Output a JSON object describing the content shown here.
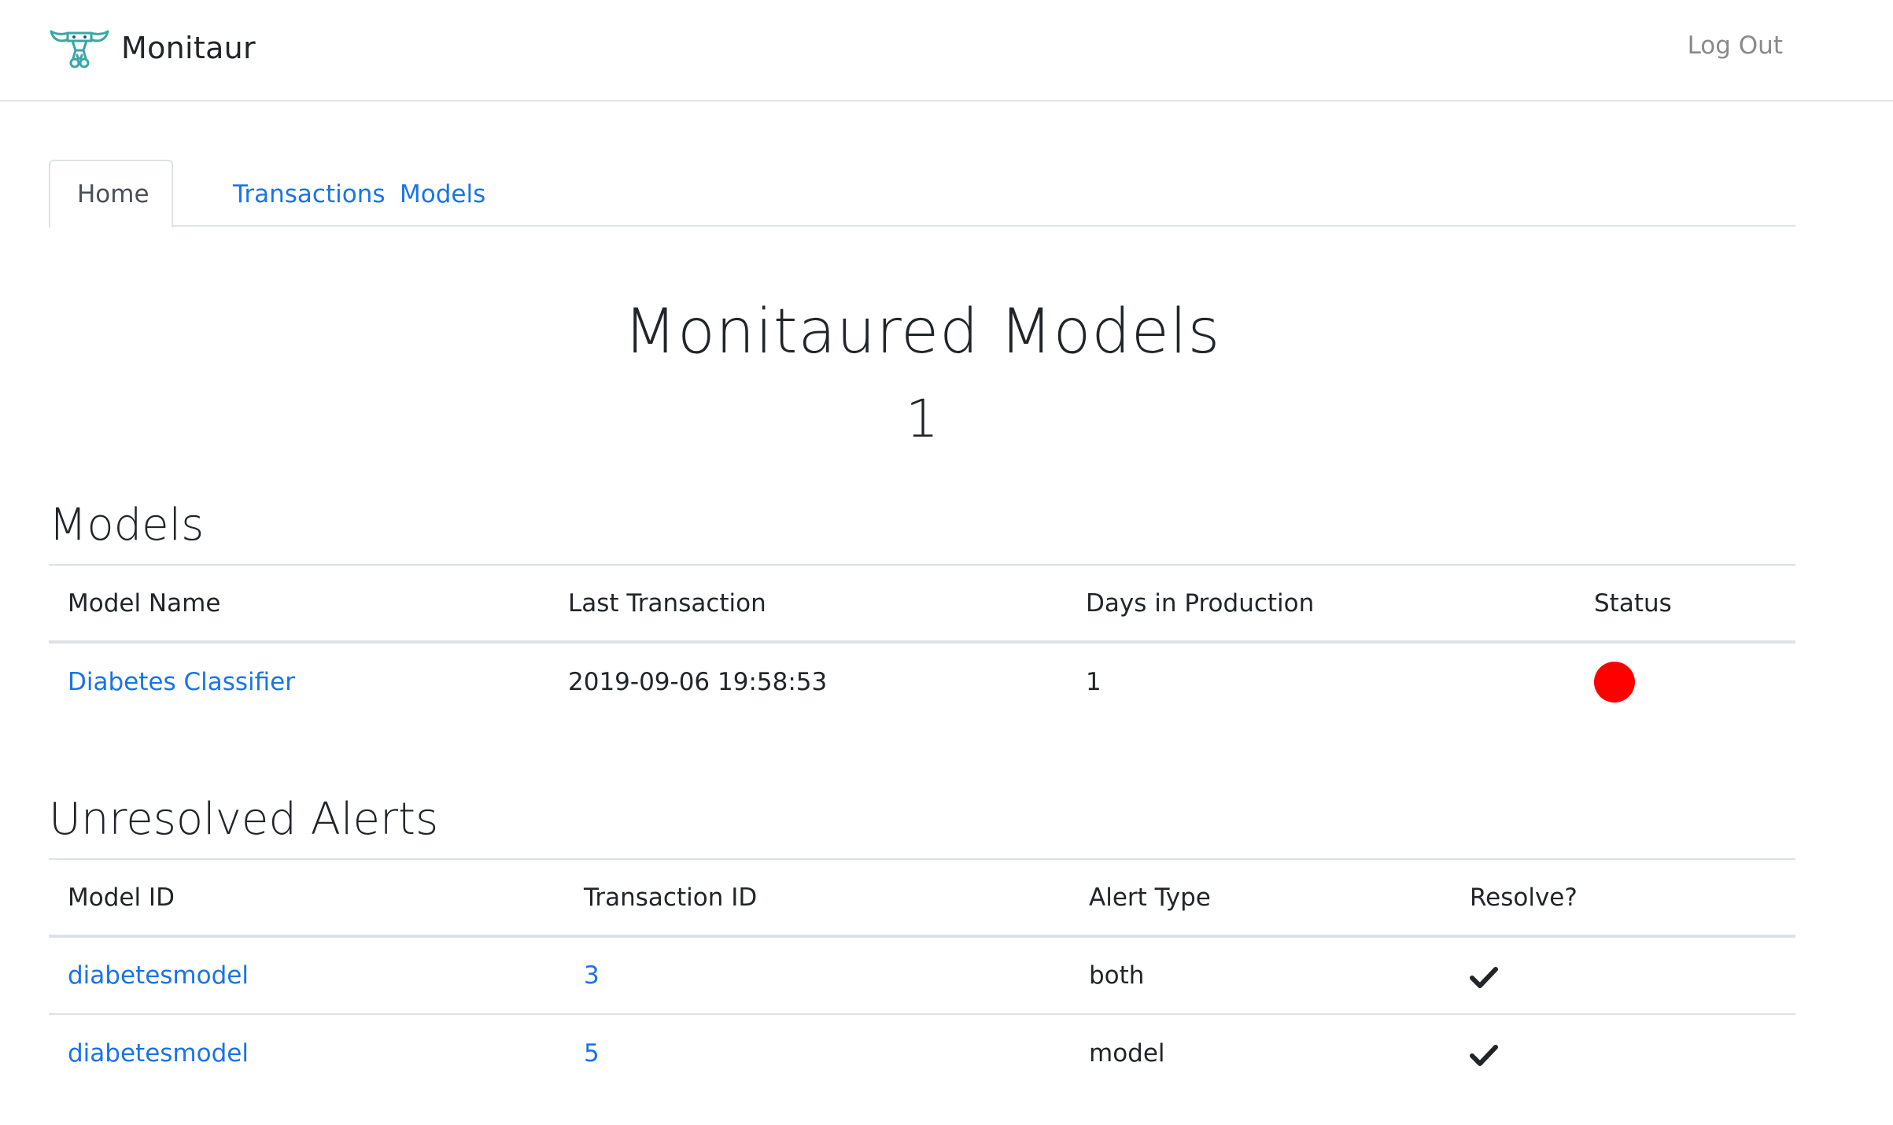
{
  "header": {
    "brand_name": "Monitaur",
    "logout_label": "Log Out",
    "logo_icon": "bull-horns-logo-icon",
    "logo_color": "#3aa6a6"
  },
  "tabs": [
    {
      "label": "Home",
      "active": true
    },
    {
      "label": "Transactions",
      "active": false
    },
    {
      "label": "Models",
      "active": false
    }
  ],
  "hero": {
    "title": "Monitaured Models",
    "count": "1"
  },
  "models_section": {
    "heading": "Models",
    "columns": [
      "Model Name",
      "Last Transaction",
      "Days in Production",
      "Status"
    ],
    "rows": [
      {
        "model_name": "Diabetes Classifier",
        "last_transaction": "2019-09-06 19:58:53",
        "days_in_production": "1",
        "status_color": "#ff0000",
        "status_icon": "status-dot-icon"
      }
    ]
  },
  "alerts_section": {
    "heading": "Unresolved Alerts",
    "columns": [
      "Model ID",
      "Transaction ID",
      "Alert Type",
      "Resolve?"
    ],
    "rows": [
      {
        "model_id": "diabetesmodel",
        "transaction_id": "3",
        "alert_type": "both",
        "resolve_icon": "checkmark-icon"
      },
      {
        "model_id": "diabetesmodel",
        "transaction_id": "5",
        "alert_type": "model",
        "resolve_icon": "checkmark-icon"
      }
    ]
  },
  "colors": {
    "link": "#1a73e8",
    "text": "#212529",
    "muted": "#8a8a8a",
    "border": "#dee2e6",
    "status_red": "#ff0000"
  }
}
